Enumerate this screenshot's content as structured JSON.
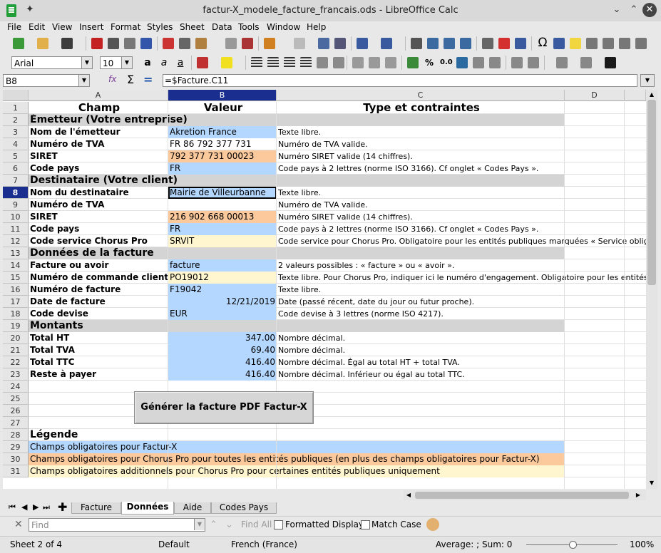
{
  "window": {
    "title": "factur-X_modele_facture_francais.ods - LibreOffice Calc"
  },
  "menu": [
    "File",
    "Edit",
    "View",
    "Insert",
    "Format",
    "Styles",
    "Sheet",
    "Data",
    "Tools",
    "Window",
    "Help"
  ],
  "format": {
    "font_name": "Arial",
    "font_size": "10"
  },
  "formula_bar": {
    "cell_ref": "B8",
    "formula": "=$Facture.C11",
    "sum_icon": "Σ",
    "equal_icon": "="
  },
  "columns": [
    "A",
    "B",
    "C",
    "D"
  ],
  "selected": {
    "row": "8",
    "col": "B"
  },
  "rows": [
    {
      "n": "1",
      "a": "Champ",
      "b": "Valeur",
      "c": "Type et contraintes",
      "style": "header"
    },
    {
      "n": "2",
      "a": "Émetteur (Votre entreprise)",
      "b": "",
      "c": "",
      "style": "section"
    },
    {
      "n": "3",
      "a": "Nom de l'émetteur",
      "b": "Akretion France",
      "c": "Texte libre.",
      "bcolor": "blue"
    },
    {
      "n": "4",
      "a": "Numéro de TVA",
      "b": "FR 86 792 377 731",
      "c": "Numéro de TVA valide.",
      "bcolor": ""
    },
    {
      "n": "5",
      "a": "SIRET",
      "b": "792 377 731 00023",
      "c": "Numéro SIRET valide (14 chiffres).",
      "bcolor": "orange"
    },
    {
      "n": "6",
      "a": "Code pays",
      "b": "FR",
      "c": "Code pays à 2 lettres (norme ISO 3166). Cf onglet « Codes Pays ».",
      "bcolor": "blue"
    },
    {
      "n": "7",
      "a": "Destinataire (Votre client)",
      "b": "",
      "c": "",
      "style": "section"
    },
    {
      "n": "8",
      "a": "Nom du destinataire",
      "b": "Mairie de Villeurbanne",
      "c": "Texte libre.",
      "bcolor": "blue"
    },
    {
      "n": "9",
      "a": "Numéro de TVA",
      "b": "",
      "c": "Numéro de TVA valide.",
      "bcolor": ""
    },
    {
      "n": "10",
      "a": "SIRET",
      "b": "216 902 668 00013",
      "c": "Numéro SIRET valide (14 chiffres).",
      "bcolor": "orange"
    },
    {
      "n": "11",
      "a": "Code pays",
      "b": "FR",
      "c": "Code pays à 2 lettres (norme ISO 3166). Cf onglet « Codes Pays ».",
      "bcolor": "blue"
    },
    {
      "n": "12",
      "a": "Code service Chorus Pro",
      "b": "SRVIT",
      "c": "Code service pour Chorus Pro. Obligatoire pour les entités publiques marquées « Service obligatoire »",
      "bcolor": "yellow"
    },
    {
      "n": "13",
      "a": "Données de la facture",
      "b": "",
      "c": "",
      "style": "section"
    },
    {
      "n": "14",
      "a": "Facture ou avoir",
      "b": "facture",
      "c": "2 valeurs possibles : « facture » ou « avoir ».",
      "bcolor": "blue"
    },
    {
      "n": "15",
      "a": "Numéro de commande client",
      "b": "PO19012",
      "c": "Texte libre. Pour Chorus Pro, indiquer ici le numéro d'engagement. Obligatoire pour les entités publiques",
      "bcolor": "yellow"
    },
    {
      "n": "16",
      "a": "Numéro de facture",
      "b": "F19042",
      "c": "Texte libre.",
      "bcolor": "blue"
    },
    {
      "n": "17",
      "a": "Date de facture",
      "b": "12/21/2019",
      "c": "Date (passé récent, date du jour ou futur proche).",
      "bcolor": "blue",
      "bright": true
    },
    {
      "n": "18",
      "a": "Code devise",
      "b": "EUR",
      "c": "Code devise à 3 lettres (norme ISO 4217).",
      "bcolor": "blue"
    },
    {
      "n": "19",
      "a": "Montants",
      "b": "",
      "c": "",
      "style": "section"
    },
    {
      "n": "20",
      "a": "Total HT",
      "b": "347.00",
      "c": "Nombre décimal.",
      "bcolor": "blue",
      "bright": true
    },
    {
      "n": "21",
      "a": "Total TVA",
      "b": "69.40",
      "c": "Nombre décimal.",
      "bcolor": "blue",
      "bright": true
    },
    {
      "n": "22",
      "a": "Total TTC",
      "b": "416.40",
      "c": "Nombre décimal. Égal au total HT + total TVA.",
      "bcolor": "blue",
      "bright": true
    },
    {
      "n": "23",
      "a": "Reste à payer",
      "b": "416.40",
      "c": "Nombre décimal. Inférieur ou égal au total TTC.",
      "bcolor": "blue",
      "bright": true
    },
    {
      "n": "24",
      "a": "",
      "b": "",
      "c": ""
    },
    {
      "n": "25",
      "a": "",
      "b": "",
      "c": ""
    },
    {
      "n": "26",
      "a": "",
      "b": "",
      "c": ""
    },
    {
      "n": "27",
      "a": "",
      "b": "",
      "c": ""
    },
    {
      "n": "28",
      "a": "Légende",
      "b": "",
      "c": "",
      "style": "legend-title"
    },
    {
      "n": "29",
      "a": "Champs obligatoires pour Factur-X",
      "style": "legend",
      "color": "blue"
    },
    {
      "n": "30",
      "a": "Champs obligatoires pour Chorus Pro pour toutes les entités publiques (en plus des champs obligatoires pour Factur-X)",
      "style": "legend",
      "color": "orange"
    },
    {
      "n": "31",
      "a": "Champs obligatoires additionnels pour Chorus Pro pour certaines entités publiques uniquement",
      "style": "legend",
      "color": "yellow"
    }
  ],
  "pdf_button": "Générer la facture PDF Factur-X",
  "sheet_tabs": [
    {
      "label": "Facture",
      "active": false
    },
    {
      "label": "Données",
      "active": true
    },
    {
      "label": "Aide",
      "active": false
    },
    {
      "label": "Codes Pays",
      "active": false
    }
  ],
  "findbar": {
    "placeholder": "Find",
    "find_all": "Find All",
    "formatted_display": "Formatted Display",
    "match_case": "Match Case"
  },
  "status": {
    "sheet": "Sheet 2 of 4",
    "style": "Default",
    "language": "French (France)",
    "summary": "Average: ; Sum: 0",
    "zoom": "100%"
  },
  "colors": {
    "blue": "#b4d7ff",
    "orange": "#fbc99c",
    "yellow": "#fff5ce",
    "section_gray": "#d4d4d4",
    "selected_header": "#1a2e8f"
  }
}
